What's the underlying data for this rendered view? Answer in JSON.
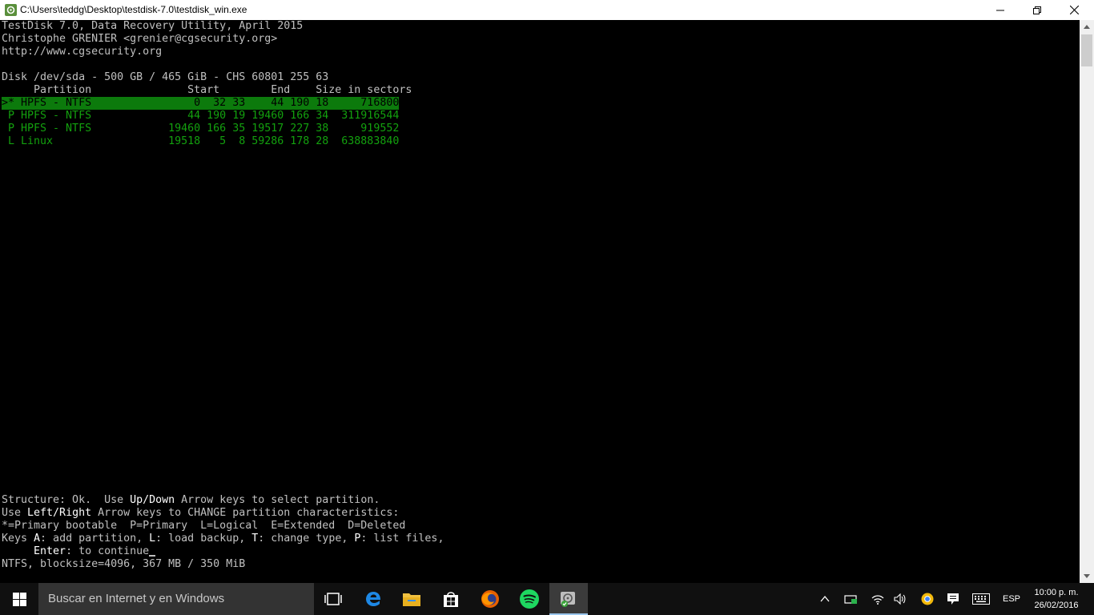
{
  "window": {
    "title": "C:\\Users\\teddg\\Desktop\\testdisk-7.0\\testdisk_win.exe"
  },
  "console": {
    "header_line1": "TestDisk 7.0, Data Recovery Utility, April 2015",
    "header_line2": "Christophe GRENIER <grenier@cgsecurity.org>",
    "header_line3": "http://www.cgsecurity.org",
    "disk_info": "Disk /dev/sda - 500 GB / 465 GiB - CHS 60801 255 63",
    "table_header": "     Partition               Start        End    Size in sectors",
    "partitions": [
      {
        "text": ">* HPFS - NTFS                0  32 33    44 190 18     716800",
        "selected": true
      },
      {
        "text": " P HPFS - NTFS               44 190 19 19460 166 34  311916544",
        "selected": false
      },
      {
        "text": " P HPFS - NTFS            19460 166 35 19517 227 38     919552",
        "selected": false
      },
      {
        "text": " L Linux                  19518   5  8 59286 178 28  638883840",
        "selected": false
      }
    ],
    "footer": {
      "line1_a": "Structure: Ok.  Use ",
      "line1_key": "Up/Down",
      "line1_b": " Arrow keys to select partition.",
      "line2_a": "Use ",
      "line2_key": "Left/Right",
      "line2_b": " Arrow keys to CHANGE partition characteristics:",
      "line3": "*=Primary bootable  P=Primary  L=Logical  E=Extended  D=Deleted",
      "line4_a": "Keys ",
      "line4_k1": "A",
      "line4_b": ": add partition, ",
      "line4_k2": "L",
      "line4_c": ": load backup, ",
      "line4_k3": "T",
      "line4_d": ": change type, ",
      "line4_k4": "P",
      "line4_e": ": list files,",
      "line5_indent": "     ",
      "line5_key": "Enter",
      "line5_b": ": to continue",
      "status": "NTFS, blocksize=4096, 367 MB / 350 MiB"
    }
  },
  "taskbar": {
    "search_placeholder": "Buscar en Internet y en Windows",
    "language": "ESP",
    "time": "10:00 p. m.",
    "date": "26/02/2016"
  },
  "colors": {
    "console_bg": "#000000",
    "console_fg": "#c0c0c0",
    "partition_green": "#13a10e",
    "selected_bg": "#0c7a0c",
    "taskbar_bg": "#101010"
  },
  "icons": {
    "app": "testdisk-icon",
    "minimize": "minimize-icon",
    "maximize": "restore-icon",
    "close": "close-icon",
    "start": "windows-logo-icon",
    "taskview": "task-view-icon",
    "edge": "edge-icon",
    "explorer": "file-explorer-icon",
    "store": "store-icon",
    "firefox": "firefox-icon",
    "spotify": "spotify-icon",
    "testdisk_taskbar": "testdisk-icon"
  }
}
